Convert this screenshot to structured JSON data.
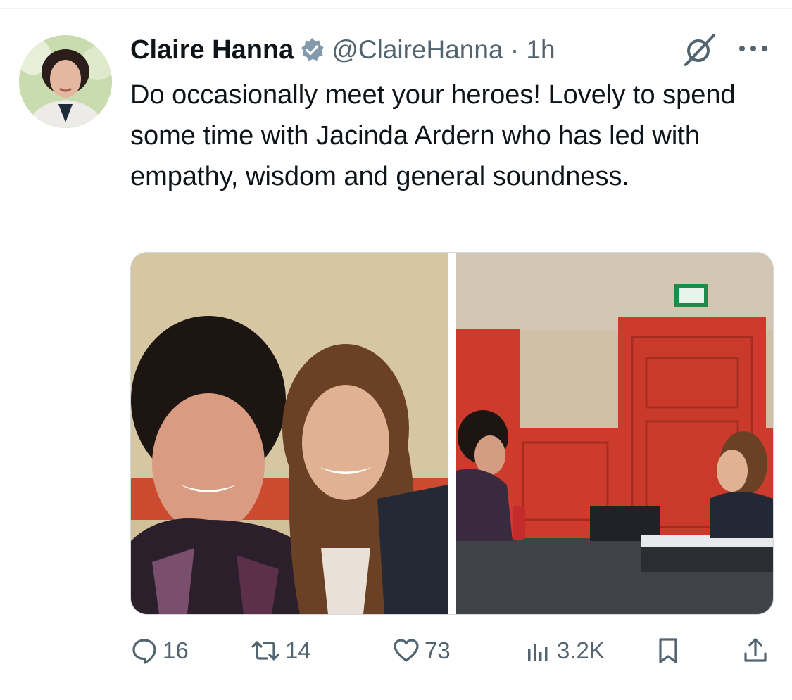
{
  "tweet": {
    "author_name": "Claire Hanna",
    "handle_time": "@ClaireHanna · 1h",
    "text": "Do occasionally meet your heroes! Lovely to spend some time with Jacinda Ardern who has led with empathy, wisdom and general soundness."
  },
  "actions": {
    "replies": "16",
    "reposts": "14",
    "likes": "73",
    "views": "3.2K"
  },
  "colors": {
    "text": "#0f1419",
    "secondary": "#536471",
    "verified": "#829aab",
    "red_wall": "#cc3b2b"
  }
}
